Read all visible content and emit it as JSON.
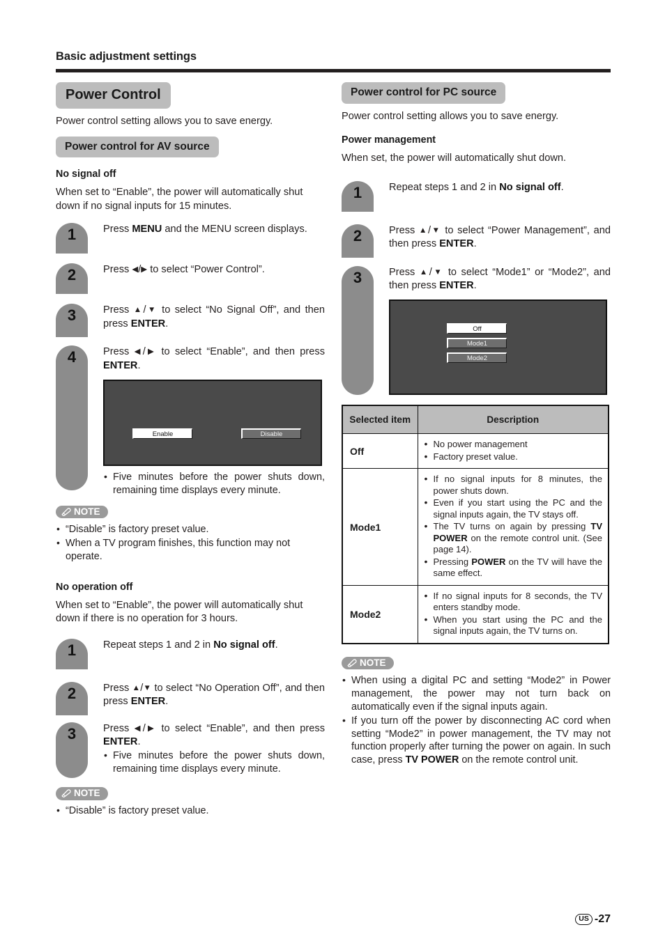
{
  "header": {
    "title": "Basic adjustment settings"
  },
  "left": {
    "banner_main": "Power Control",
    "intro": "Power control setting allows you to save energy.",
    "banner_av": "Power control for AV source",
    "section1": {
      "heading": "No signal off",
      "desc": "When set to “Enable”, the power will automatically shut down if no signal inputs for 15 minutes.",
      "steps": [
        {
          "num": "1",
          "text_html": "Press <b>MENU</b> and the MENU screen displays."
        },
        {
          "num": "2",
          "text_html": "Press <span class=\"ar\">◀</span>/<span class=\"ar\">▶</span> to select “Power Control”."
        },
        {
          "num": "3",
          "text_html": "Press <span class=\"ar\">▲</span>/<span class=\"ar\">▼</span> to select “No Signal Off”, and then press <b>ENTER</b>."
        },
        {
          "num": "4",
          "text_html": "Press <span class=\"ar\">◀</span>/<span class=\"ar\">▶</span> to select “Enable”, and then press <b>ENTER</b>."
        }
      ],
      "screen": {
        "enable_label": "Enable",
        "disable_label": "Disable"
      },
      "after_screen_bullet": "Five minutes before the power shuts down, remaining time displays every minute.",
      "note_label": "NOTE",
      "notes": [
        "“Disable” is factory preset value.",
        "When a TV program finishes, this function may not operate."
      ]
    },
    "section2": {
      "heading": "No operation off",
      "desc": "When set to “Enable”, the power will automatically shut down if there is no operation for 3 hours.",
      "steps": [
        {
          "num": "1",
          "text_html": "Repeat steps 1 and 2 in <b>No signal off</b>."
        },
        {
          "num": "2",
          "text_html": "Press <span class=\"ar\">▲</span>/<span class=\"ar\">▼</span> to select “No Operation Off”, and then press <b>ENTER</b>."
        },
        {
          "num": "3",
          "text_html": "Press <span class=\"ar\">◀</span>/<span class=\"ar\">▶</span> to select “Enable”, and then press <b>ENTER</b>."
        }
      ],
      "step3_bullet": "Five minutes before the power shuts down, remaining time displays every minute.",
      "note_label": "NOTE",
      "notes": [
        "“Disable” is factory preset value."
      ]
    }
  },
  "right": {
    "banner_pc": "Power control for PC source",
    "intro": "Power control setting allows you to save energy.",
    "heading": "Power management",
    "desc": "When set, the power will automatically shut down.",
    "steps": [
      {
        "num": "1",
        "text_html": "Repeat steps 1 and 2 in <b>No signal off</b>."
      },
      {
        "num": "2",
        "text_html": "Press <span class=\"ar\">▲</span>/<span class=\"ar\">▼</span> to select “Power Management”, and then press <b>ENTER</b>."
      },
      {
        "num": "3",
        "text_html": "Press <span class=\"ar\">▲</span>/<span class=\"ar\">▼</span> to select “Mode1” or “Mode2”, and then press <b>ENTER</b>."
      }
    ],
    "screen": {
      "off_label": "Off",
      "mode1_label": "Mode1",
      "mode2_label": "Mode2"
    },
    "table": {
      "headers": [
        "Selected item",
        "Description"
      ],
      "rows": [
        {
          "item": "Off",
          "bullets_html": [
            "No power management",
            "Factory preset value."
          ]
        },
        {
          "item": "Mode1",
          "bullets_html": [
            "If no signal inputs for 8 minutes, the power shuts down.",
            "Even if you start using the PC and the signal inputs again, the TV stays off.",
            "The TV turns on again by pressing <b>TV POWER</b> on the remote control unit. (See page 14).",
            "Pressing <b>POWER</b> on the TV will have the same effect."
          ]
        },
        {
          "item": "Mode2",
          "bullets_html": [
            "If no signal inputs for 8 seconds, the TV enters standby mode.",
            "When you start using the PC and the signal inputs again, the TV turns on."
          ]
        }
      ]
    },
    "note_label": "NOTE",
    "notes_html": [
      "When using a digital PC and setting “Mode2” in Power management, the power may not turn back on automatically even if the signal inputs again.",
      "If you turn off the power by disconnecting AC cord when setting “Mode2” in power management, the TV may not function properly after turning the power on again. In such case, press <b>TV POWER</b> on the remote control unit."
    ]
  },
  "footer": {
    "region": "US",
    "page": "-27"
  }
}
